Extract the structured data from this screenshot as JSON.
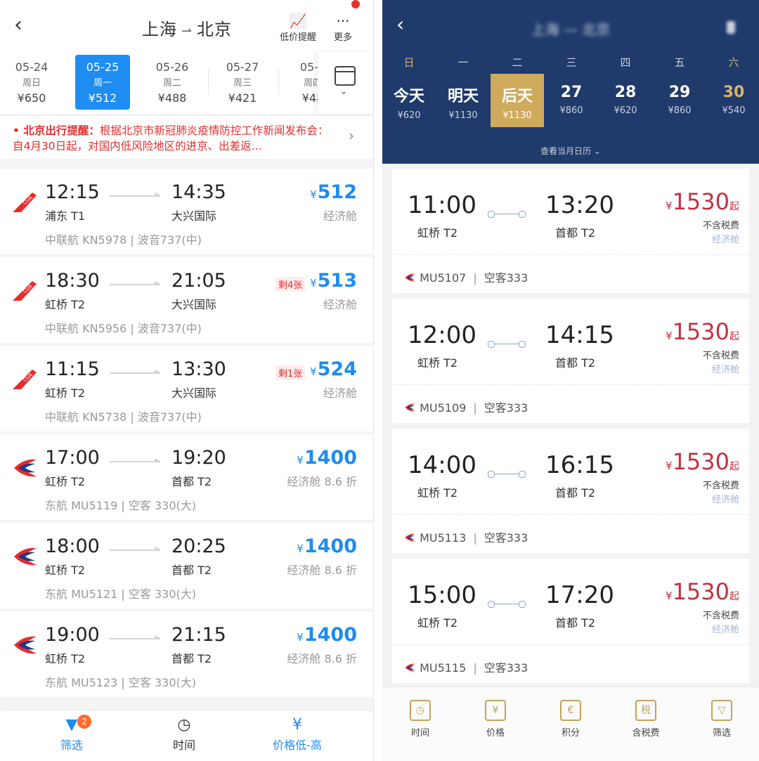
{
  "left": {
    "title_from": "上海",
    "title_to": "北京",
    "header_actions": {
      "alert_label": "低价提醒",
      "more_label": "更多"
    },
    "dates": [
      {
        "date": "05-24",
        "weekday": "周日",
        "price": "¥650"
      },
      {
        "date": "05-25",
        "weekday": "周一",
        "price": "¥512",
        "active": true
      },
      {
        "date": "05-26",
        "weekday": "周二",
        "price": "¥488"
      },
      {
        "date": "05-27",
        "weekday": "周三",
        "price": "¥421"
      },
      {
        "date": "05-2",
        "weekday": "周四",
        "price": "¥48"
      }
    ],
    "notice": {
      "prefix": "北京出行提醒：",
      "text": "根据北京市新冠肺炎疫情防控工作新闻发布会：自4月30日起，对国内低风险地区的进京、出差返…"
    },
    "flights": [
      {
        "dep_time": "12:15",
        "dep_airport": "浦东 T1",
        "arr_time": "14:35",
        "arr_airport": "大兴国际",
        "price_sym": "¥",
        "price": "512",
        "cabin": "经济舱",
        "info": "中联航 KN5978 | 波音737(中)",
        "badge": "",
        "airline": "CUA"
      },
      {
        "dep_time": "18:30",
        "dep_airport": "虹桥 T2",
        "arr_time": "21:05",
        "arr_airport": "大兴国际",
        "price_sym": "¥",
        "price": "513",
        "cabin": "经济舱",
        "info": "中联航 KN5956 | 波音737(中)",
        "badge": "剩4张",
        "airline": "CUA"
      },
      {
        "dep_time": "11:15",
        "dep_airport": "虹桥 T2",
        "arr_time": "13:30",
        "arr_airport": "大兴国际",
        "price_sym": "¥",
        "price": "524",
        "cabin": "经济舱",
        "info": "中联航 KN5738 | 波音737(中)",
        "badge": "剩1张",
        "airline": "CUA"
      },
      {
        "dep_time": "17:00",
        "dep_airport": "虹桥 T2",
        "arr_time": "19:20",
        "arr_airport": "首都 T2",
        "price_sym": "¥",
        "price": "1400",
        "cabin": "经济舱 8.6 折",
        "info": "东航 MU5119 | 空客 330(大)",
        "badge": "",
        "airline": "MU"
      },
      {
        "dep_time": "18:00",
        "dep_airport": "虹桥 T2",
        "arr_time": "20:25",
        "arr_airport": "首都 T2",
        "price_sym": "¥",
        "price": "1400",
        "cabin": "经济舱 8.6 折",
        "info": "东航 MU5121 | 空客 330(大)",
        "badge": "",
        "airline": "MU"
      },
      {
        "dep_time": "19:00",
        "dep_airport": "虹桥 T2",
        "arr_time": "21:15",
        "arr_airport": "首都 T2",
        "price_sym": "¥",
        "price": "1400",
        "cabin": "经济舱 8.6 折",
        "info": "东航 MU5123 | 空客 330(大)",
        "badge": "",
        "airline": "MU"
      }
    ],
    "tabs": {
      "filter": "筛选",
      "filter_count": "2",
      "time": "时间",
      "price": "价格低-高"
    },
    "colors": {
      "accent": "#1e8cf0",
      "alert": "#e62c2c"
    }
  },
  "right": {
    "title": "上海 — 北京",
    "weekdays": [
      "日",
      "一",
      "二",
      "三",
      "四",
      "五",
      "六"
    ],
    "days": [
      {
        "label": "今天",
        "price": "¥620"
      },
      {
        "label": "明天",
        "price": "¥1130"
      },
      {
        "label": "后天",
        "price": "¥1130",
        "active": true
      },
      {
        "label": "27",
        "price": "¥860"
      },
      {
        "label": "28",
        "price": "¥620"
      },
      {
        "label": "29",
        "price": "¥860"
      },
      {
        "label": "30",
        "price": "¥540",
        "gold": true
      }
    ],
    "month_link": "查看当月日历",
    "flights": [
      {
        "dep_time": "11:00",
        "dep_airport": "虹桥 T2",
        "arr_time": "13:20",
        "arr_airport": "首都 T2",
        "price_sym": "¥",
        "price": "1530",
        "qi": "起",
        "tax": "不含税费",
        "cabin": "经济舱",
        "flight": "MU5107",
        "aircraft": "空客333"
      },
      {
        "dep_time": "12:00",
        "dep_airport": "虹桥 T2",
        "arr_time": "14:15",
        "arr_airport": "首都 T2",
        "price_sym": "¥",
        "price": "1530",
        "qi": "起",
        "tax": "不含税费",
        "cabin": "经济舱",
        "flight": "MU5109",
        "aircraft": "空客333"
      },
      {
        "dep_time": "14:00",
        "dep_airport": "虹桥 T2",
        "arr_time": "16:15",
        "arr_airport": "首都 T2",
        "price_sym": "¥",
        "price": "1530",
        "qi": "起",
        "tax": "不含税费",
        "cabin": "经济舱",
        "flight": "MU5113",
        "aircraft": "空客333"
      },
      {
        "dep_time": "15:00",
        "dep_airport": "虹桥 T2",
        "arr_time": "17:20",
        "arr_airport": "首都 T2",
        "price_sym": "¥",
        "price": "1530",
        "qi": "起",
        "tax": "不含税费",
        "cabin": "经济舱",
        "flight": "MU5115",
        "aircraft": "空客333"
      }
    ],
    "tabs": [
      {
        "label": "时间",
        "icon": "home-clock-icon",
        "glyph": "◷"
      },
      {
        "label": "价格",
        "icon": "home-yen-icon",
        "glyph": "¥"
      },
      {
        "label": "积分",
        "icon": "coins-icon",
        "glyph": "€"
      },
      {
        "label": "含税费",
        "icon": "tax-icon",
        "glyph": "税"
      },
      {
        "label": "筛选",
        "icon": "funnel-icon",
        "glyph": "▽"
      }
    ],
    "colors": {
      "header": "#1f3a6b",
      "gold": "#cfaa5b",
      "price": "#c2313f"
    }
  }
}
